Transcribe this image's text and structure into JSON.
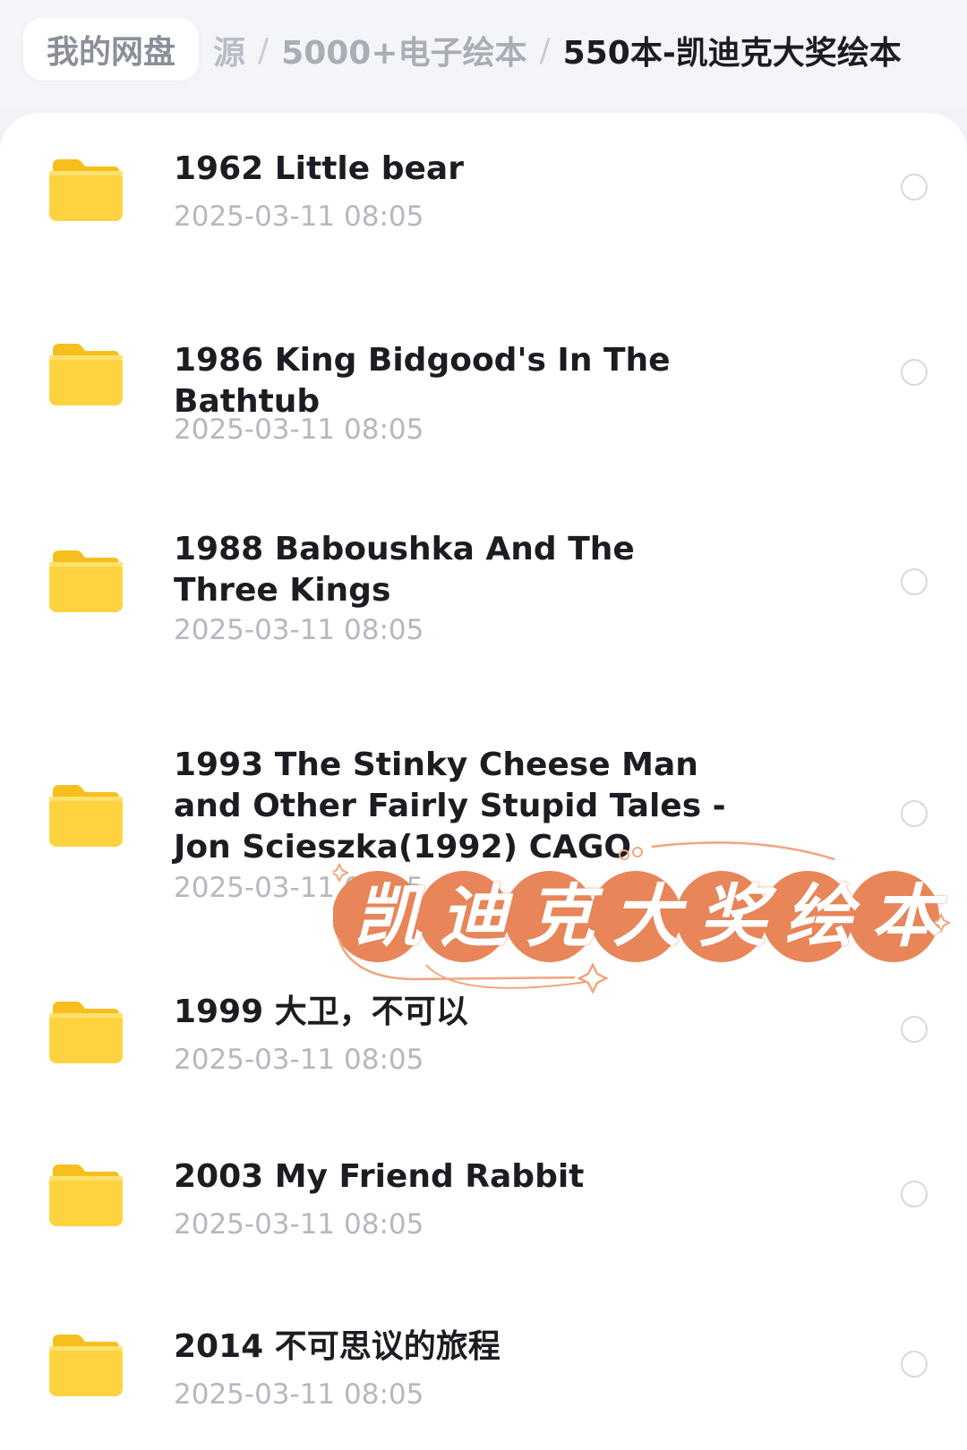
{
  "breadcrumb": {
    "root": "我的网盘",
    "faded": "源",
    "separator": "/",
    "middle": "5000+电子绘本",
    "current": "550本-凯迪克大奖绘本"
  },
  "files": [
    {
      "name": "1962 Little bear",
      "date": "2025-03-11 08:05"
    },
    {
      "name": "1986 King Bidgood's In The Bathtub",
      "date": "2025-03-11 08:05"
    },
    {
      "name": "1988 Baboushka And The Three Kings",
      "date": "2025-03-11 08:05"
    },
    {
      "name": "1993 The Stinky Cheese Man and Other Fairly Stupid Tales - Jon Scieszka(1992) CAGO",
      "date": "2025-03-11 08:05"
    },
    {
      "name": "1999 大卫，不可以",
      "date": "2025-03-11 08:05"
    },
    {
      "name": "2003 My Friend Rabbit",
      "date": "2025-03-11 08:05"
    },
    {
      "name": "2014 不可思议的旅程",
      "date": "2025-03-11 08:05"
    }
  ],
  "overlay": {
    "text": "凯迪克大奖绘本",
    "chars": [
      "凯",
      "迪",
      "克",
      "大",
      "奖",
      "绘",
      "本"
    ],
    "circle_color": "#e8865a",
    "accent_color": "#f1a57c"
  },
  "colors": {
    "folder": "#ffd23f",
    "folder_tab": "#f9c21e",
    "title_text": "#1c1d22",
    "date_text": "#b4b8c0",
    "check_border": "#d6d8dd"
  }
}
